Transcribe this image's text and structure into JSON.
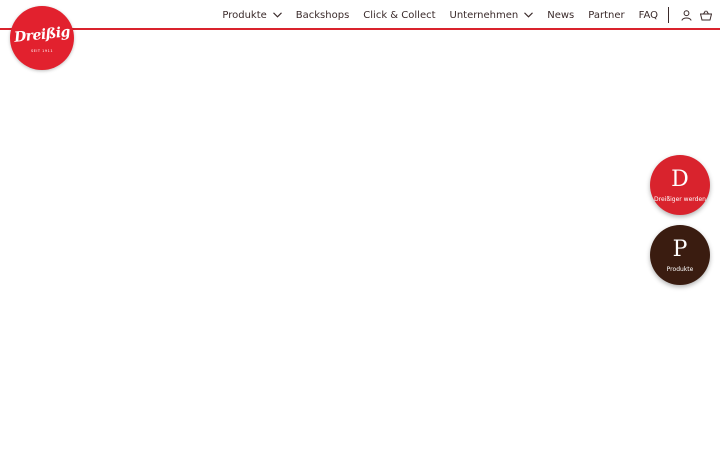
{
  "brand": {
    "logo_text": "Dreißig",
    "logo_est": "SEIT 1911"
  },
  "nav": {
    "items": [
      {
        "label": "Produkte",
        "dropdown": true
      },
      {
        "label": "Backshops",
        "dropdown": false
      },
      {
        "label": "Click & Collect",
        "dropdown": false
      },
      {
        "label": "Unternehmen",
        "dropdown": true
      },
      {
        "label": "News",
        "dropdown": false
      },
      {
        "label": "Partner",
        "dropdown": false
      },
      {
        "label": "FAQ",
        "dropdown": false
      }
    ],
    "icons": [
      "user-icon",
      "basket-icon"
    ]
  },
  "fabs": [
    {
      "letter": "D",
      "label": "Dreißiger werden",
      "color": "#d9232d"
    },
    {
      "letter": "P",
      "label": "Produkte",
      "color": "#3a1c10"
    }
  ],
  "colors": {
    "accent": "#d9232d",
    "dark": "#3a1c10",
    "text": "#3a2a2a"
  }
}
